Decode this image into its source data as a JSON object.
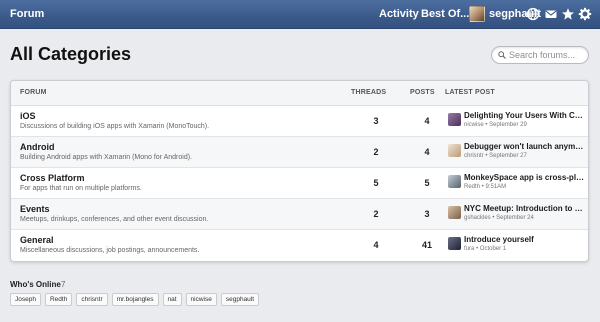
{
  "topbar": {
    "brand": "Forum",
    "nav": [
      "Activity",
      "Best Of..."
    ],
    "username": "segphault",
    "icons": [
      "user-avatar",
      "globe-icon",
      "mail-icon",
      "star-icon",
      "gear-icon"
    ]
  },
  "page": {
    "title": "All Categories",
    "search_placeholder": "Search forums..."
  },
  "table": {
    "headers": {
      "forum": "FORUM",
      "threads": "THREADS",
      "posts": "POSTS",
      "latest": "LATEST POST"
    },
    "rows": [
      {
        "name": "iOS",
        "description": "Discussions of building iOS apps with Xamarin (MonoTouch).",
        "threads": "3",
        "posts": "4",
        "latest_title": "Delighting Your Users With Cor...",
        "latest_meta": "nicwise • September 29",
        "avatar_color": "#6a4a7a"
      },
      {
        "name": "Android",
        "description": "Building Android apps with Xamarin (Mono for Android).",
        "threads": "2",
        "posts": "4",
        "latest_title": "Debugger won't launch anymor...",
        "latest_meta": "chrisntr • September 27",
        "avatar_color": "#d7c2a4"
      },
      {
        "name": "Cross Platform",
        "description": "For apps that run on multiple platforms.",
        "threads": "5",
        "posts": "5",
        "latest_title": "MonkeySpace app is cross-plat...",
        "latest_meta": "Redth • 9:51AM",
        "avatar_color": "#7a8a9a"
      },
      {
        "name": "Events",
        "description": "Meetups, drinkups, conferences, and other event discussion.",
        "threads": "2",
        "posts": "3",
        "latest_title": "NYC Meetup: Introduction to M...",
        "latest_meta": "gshackles • September 24",
        "avatar_color": "#a08a70"
      },
      {
        "name": "General",
        "description": "Miscellaneous discussions, job postings, announcements.",
        "threads": "4",
        "posts": "41",
        "latest_title": "Introduce yourself",
        "latest_meta": "fura • October 1",
        "avatar_color": "#3a3f55"
      }
    ]
  },
  "online": {
    "title": "Who's Online",
    "count": "7",
    "users": [
      "Joseph",
      "Redth",
      "chrisntr",
      "mr.bojangles",
      "nat",
      "nicwise",
      "segphault"
    ]
  }
}
